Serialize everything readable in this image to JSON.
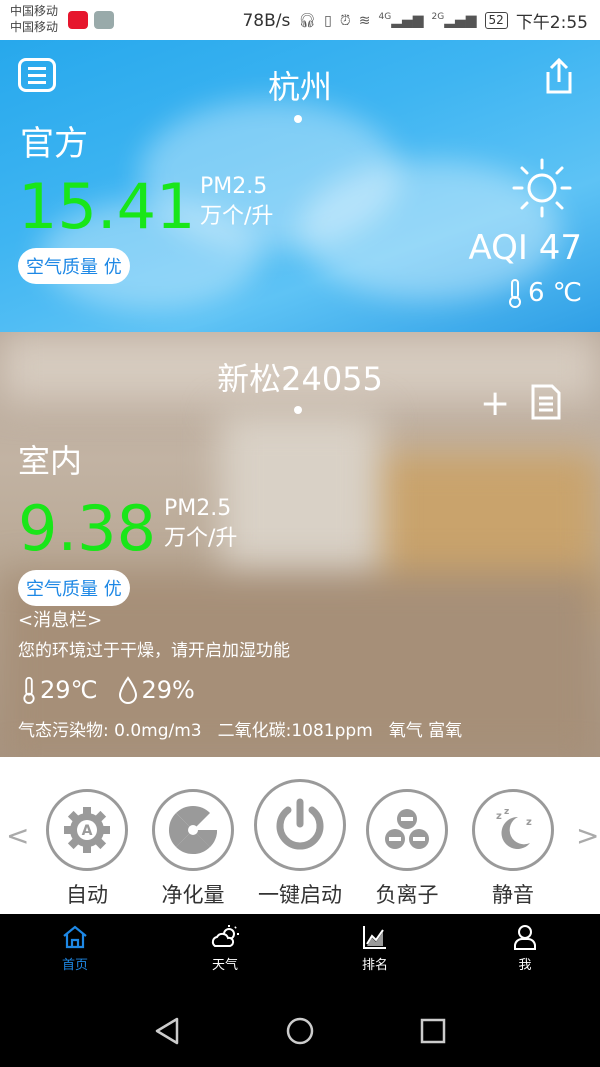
{
  "status_bar": {
    "carrier1": "中国移动",
    "carrier2": "中国移动",
    "net_speed": "78B/s",
    "net_4g": "4G",
    "net_2g": "2G",
    "battery": "52",
    "time": "下午2:55"
  },
  "weather": {
    "city": "杭州",
    "source": "官方",
    "pm_value": "15.41",
    "pm_label": "PM2.5",
    "pm_unit": "万个/升",
    "air_quality": "空气质量 优",
    "aqi": "AQI 47",
    "temperature": "6 ℃",
    "icon": "sun-icon"
  },
  "device": {
    "name": "新松24055",
    "location": "室内",
    "pm_value": "9.38",
    "pm_label": "PM2.5",
    "pm_unit": "万个/升",
    "air_quality": "空气质量 优",
    "message_title": "<消息栏>",
    "message": "您的环境过于干燥，请开启加湿功能",
    "temperature": "29℃",
    "humidity": "29%",
    "pollutant": "气态污染物: 0.0mg/m3",
    "co2": "二氧化碳:1081ppm",
    "oxygen": "氧气 富氧"
  },
  "controls": {
    "prev": "<",
    "next": ">",
    "items": [
      {
        "label": "自动",
        "icon": "auto-gear-icon"
      },
      {
        "label": "净化量",
        "icon": "fan-icon"
      },
      {
        "label": "一键启动",
        "icon": "power-icon"
      },
      {
        "label": "负离子",
        "icon": "ion-icon"
      },
      {
        "label": "静音",
        "icon": "moon-sleep-icon"
      }
    ]
  },
  "tabs": [
    {
      "label": "首页",
      "icon": "home-icon",
      "active": true
    },
    {
      "label": "天气",
      "icon": "weather-icon",
      "active": false
    },
    {
      "label": "排名",
      "icon": "chart-icon",
      "active": false
    },
    {
      "label": "我",
      "icon": "user-icon",
      "active": false
    }
  ],
  "colors": {
    "accent": "#1e88e5",
    "pm_green": "#19e619",
    "sky_blue": "#2fa9ee"
  }
}
